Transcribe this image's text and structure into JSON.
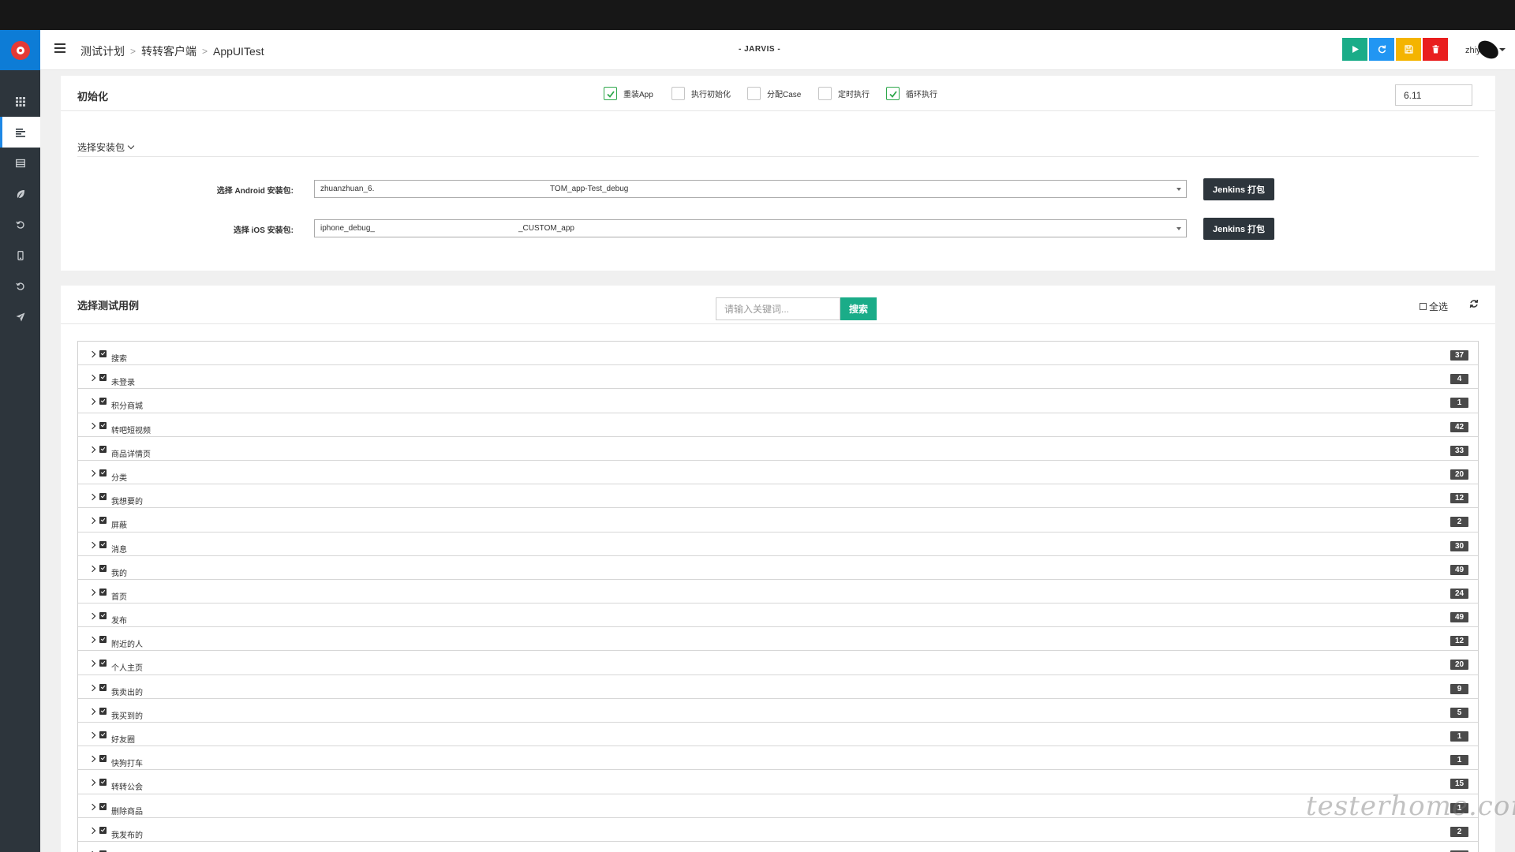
{
  "navbar": {
    "breadcrumb": [
      "测试计划",
      "转转客户端",
      "AppUITest"
    ],
    "brand": "- JARVIS -",
    "user_name": "zhiy",
    "toolbar": [
      {
        "name": "run-button",
        "icon": "play-icon",
        "color": "#1aac88"
      },
      {
        "name": "reload-button",
        "icon": "refresh-icon",
        "color": "#2196f3"
      },
      {
        "name": "save-button",
        "icon": "floppy-icon",
        "color": "#f4b400"
      },
      {
        "name": "delete-button",
        "icon": "trash-icon",
        "color": "#e91e1e"
      }
    ]
  },
  "sidebar": {
    "items": [
      {
        "name": "grid-icon",
        "active": false
      },
      {
        "name": "list-icon",
        "active": true
      },
      {
        "name": "table-icon",
        "active": false
      },
      {
        "name": "leaf-icon",
        "active": false
      },
      {
        "name": "history-icon",
        "active": false
      },
      {
        "name": "mobile-icon",
        "active": false
      },
      {
        "name": "history-icon",
        "active": false
      },
      {
        "name": "send-icon",
        "active": false
      }
    ]
  },
  "init": {
    "title": "初始化",
    "options": [
      {
        "label": "重装App",
        "checked": true
      },
      {
        "label": "执行初始化",
        "checked": false
      },
      {
        "label": "分配Case",
        "checked": false
      },
      {
        "label": "定时执行",
        "checked": false
      },
      {
        "label": "循环执行",
        "checked": true
      }
    ],
    "version": "6.11",
    "install_package_label": "选择安装包",
    "android_label": "选择 Android 安装包:",
    "android_value_left": "zhuanzhuan_6.",
    "android_value_right": "TOM_app-Test_debug",
    "ios_label": "选择 iOS 安装包:",
    "ios_value_left": "iphone_debug_",
    "ios_value_right": "_CUSTOM_app",
    "jenkins_label": "Jenkins 打包"
  },
  "cases": {
    "title": "选择测试用例",
    "search_placeholder": "请输入关键词...",
    "search_button": "搜索",
    "select_all": "全选",
    "items": [
      {
        "label": "搜索",
        "count": "37"
      },
      {
        "label": "未登录",
        "count": "4"
      },
      {
        "label": "积分商城",
        "count": "1"
      },
      {
        "label": "转吧短视频",
        "count": "42"
      },
      {
        "label": "商品详情页",
        "count": "33"
      },
      {
        "label": "分类",
        "count": "20"
      },
      {
        "label": "我想要的",
        "count": "12"
      },
      {
        "label": "屏蔽",
        "count": "2"
      },
      {
        "label": "消息",
        "count": "30"
      },
      {
        "label": "我的",
        "count": "49"
      },
      {
        "label": "首页",
        "count": "24"
      },
      {
        "label": "发布",
        "count": "49"
      },
      {
        "label": "附近的人",
        "count": "12"
      },
      {
        "label": "个人主页",
        "count": "20"
      },
      {
        "label": "我卖出的",
        "count": "9"
      },
      {
        "label": "我买到的",
        "count": "5"
      },
      {
        "label": "好友圈",
        "count": "1"
      },
      {
        "label": "快狗打车",
        "count": "1"
      },
      {
        "label": "转转公会",
        "count": "15"
      },
      {
        "label": "删除商品",
        "count": "1"
      },
      {
        "label": "我发布的",
        "count": "2"
      },
      {
        "label": "",
        "count": ""
      }
    ]
  },
  "watermark": "testerhome.com"
}
